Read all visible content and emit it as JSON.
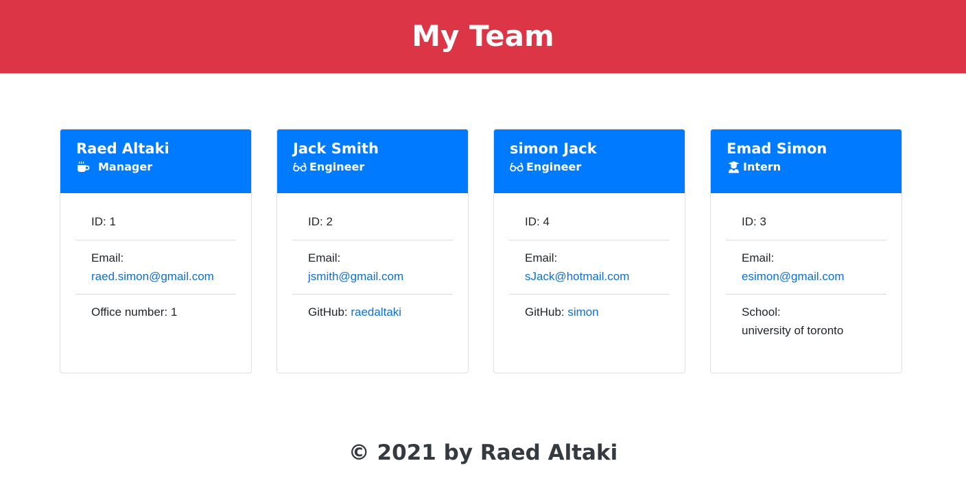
{
  "header": {
    "title": "My Team"
  },
  "colors": {
    "header_bg": "#dc3545",
    "card_header_bg": "#007bff",
    "link": "#0d6fd8"
  },
  "cards": [
    {
      "name": "Raed Altaki",
      "role": "Manager",
      "role_icon": "coffee-icon",
      "id_text": "ID: 1",
      "email_label": "Email:",
      "email": "raed.simon@gmail.com",
      "extra_label": "Office number: 1"
    },
    {
      "name": "Jack Smith",
      "role": "Engineer",
      "role_icon": "glasses-icon",
      "id_text": "ID: 2",
      "email_label": "Email:",
      "email": "jsmith@gmail.com",
      "extra_label": "GitHub: ",
      "extra_link": "raedaltaki"
    },
    {
      "name": "simon Jack",
      "role": "Engineer",
      "role_icon": "glasses-icon",
      "id_text": "ID: 4",
      "email_label": "Email:",
      "email": "sJack@hotmail.com",
      "extra_label": "GitHub: ",
      "extra_link": "simon"
    },
    {
      "name": "Emad Simon",
      "role": "Intern",
      "role_icon": "graduate-icon",
      "id_text": "ID: 3",
      "email_label": "Email:",
      "email": "esimon@gmail.com",
      "extra_label": "School:",
      "extra_value": "university of toronto"
    }
  ],
  "footer": {
    "text": "© 2021 by Raed Altaki"
  }
}
